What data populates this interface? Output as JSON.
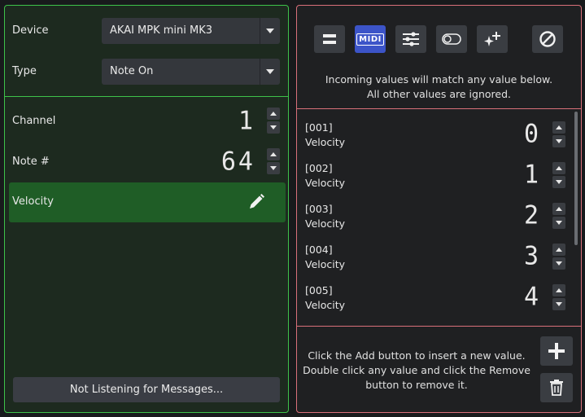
{
  "left": {
    "device_label": "Device",
    "device_value": "AKAI MPK mini MK3",
    "type_label": "Type",
    "type_value": "Note On",
    "channel_label": "Channel",
    "channel_value": "1",
    "note_label": "Note #",
    "note_value": "64",
    "velocity_label": "Velocity",
    "listen_button": "Not Listening for Messages..."
  },
  "right": {
    "toolbar": [
      "equals-icon",
      "midi-icon",
      "sliders-icon",
      "toggle-icon",
      "sparkle-plus-icon",
      "prohibit-icon"
    ],
    "midi_text": "MIDI",
    "info_line1": "Incoming values will match any value below.",
    "info_line2": "All other values are ignored.",
    "values": [
      {
        "index": "[001]",
        "label": "Velocity",
        "value": "0"
      },
      {
        "index": "[002]",
        "label": "Velocity",
        "value": "1"
      },
      {
        "index": "[003]",
        "label": "Velocity",
        "value": "2"
      },
      {
        "index": "[004]",
        "label": "Velocity",
        "value": "3"
      },
      {
        "index": "[005]",
        "label": "Velocity",
        "value": "4"
      }
    ],
    "help_line1": "Click the Add button to insert a new value.",
    "help_line2": "Double click any value and click the Remove",
    "help_line3": "button to remove it."
  },
  "colors": {
    "left_border": "#3ec24a",
    "right_border": "#d9707a",
    "active_tool": "#3c54c8",
    "selected_row": "#1f5d26"
  }
}
